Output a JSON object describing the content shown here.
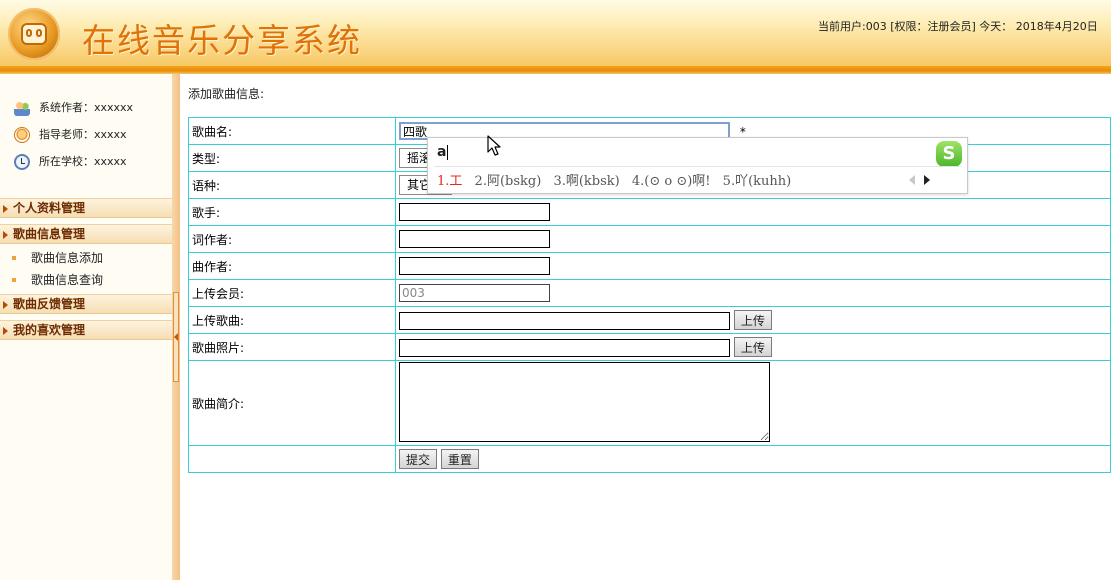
{
  "header": {
    "title": "在线音乐分享系统",
    "user_info": "当前用户:003 [权限：注册会员] 今天： 2018年4月20日"
  },
  "sidebar": {
    "info": [
      {
        "icon": "users-icon",
        "text": "系统作者：xxxxxx"
      },
      {
        "icon": "teacher-icon",
        "text": "指导老师：xxxxx"
      },
      {
        "icon": "clock-icon",
        "text": "所在学校：xxxxx"
      }
    ],
    "menus": [
      {
        "label": "个人资料管理",
        "items": []
      },
      {
        "label": "歌曲信息管理",
        "items": [
          "歌曲信息添加",
          "歌曲信息查询"
        ]
      },
      {
        "label": "歌曲反馈管理",
        "items": []
      },
      {
        "label": "我的喜欢管理",
        "items": []
      }
    ]
  },
  "main": {
    "section_title": "添加歌曲信息:",
    "fields": {
      "song_name": {
        "label": "歌曲名:",
        "value": "四歌",
        "required_mark": "*"
      },
      "type": {
        "label": "类型:",
        "selected": "摇滚"
      },
      "language": {
        "label": "语种:",
        "selected": "其它"
      },
      "singer": {
        "label": "歌手:",
        "value": ""
      },
      "lyricist": {
        "label": "词作者:",
        "value": ""
      },
      "composer": {
        "label": "曲作者:",
        "value": ""
      },
      "uploader": {
        "label": "上传会员:",
        "value": "003"
      },
      "upload_song": {
        "label": "上传歌曲:",
        "value": "",
        "button": "上传"
      },
      "song_photo": {
        "label": "歌曲照片:",
        "value": "",
        "button": "上传"
      },
      "intro": {
        "label": "歌曲简介:",
        "value": ""
      }
    },
    "buttons": {
      "submit": "提交",
      "reset": "重置"
    }
  },
  "ime": {
    "composition": "a",
    "candidates": [
      "1.工",
      "2.阿(bskg)",
      "3.啊(kbsk)",
      "4.(⊙ o ⊙)啊!",
      "5.吖(kuhh)"
    ],
    "logo_letter": "S"
  }
}
